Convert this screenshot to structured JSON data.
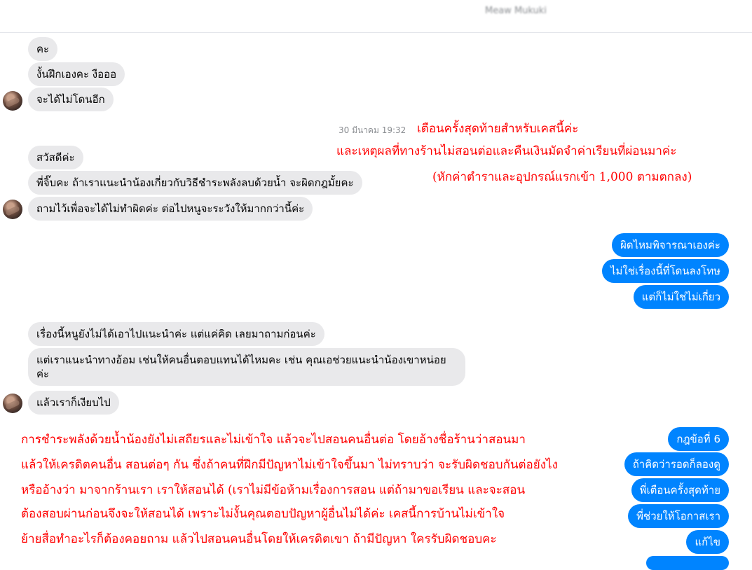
{
  "header": {
    "contact_name": "Meaw Mukuki"
  },
  "timestamp": "30 มีนาคม 19:32",
  "messages_group1": [
    "คะ",
    "งั้นฝึกเองคะ งือออ",
    "จะได้ไม่โดนอีก"
  ],
  "messages_group2": [
    "สวัสดีค่ะ",
    "พี่จิ๊บคะ ถ้าเราแนะนำน้องเกี่ยวกับวิธีชำระพลังลบด้วยน้ำ จะผิดกฎมั้ยคะ",
    "ถามไว้เพื่อจะได้ไม่ทำผิดค่ะ ต่อไปหนูจะระวังให้มากกว่านี้ค่ะ"
  ],
  "messages_out1": [
    "ผิดไหมพิจารณาเองค่ะ",
    "ไม่ใช่เรื่องนี้ที่โดนลงโทษ",
    "แต่ก็ไม่ใช่ไม่เกี่ยว"
  ],
  "messages_group3": [
    "เรื่องนี้หนูยังไม่ได้เอาไปแนะนำค่ะ แต่แค่คิด เลยมาถามก่อนค่ะ",
    "แต่เราแนะนำทางอ้อม เช่นให้คนอื่นตอบแทนได้ไหมคะ เช่น คุณเอช่วยแนะนำน้องเขาหน่อยค่ะ",
    "แล้วเราก็เงียบไป"
  ],
  "messages_out2": [
    "กฎข้อที่ 6",
    "ถ้าคิดว่ารอดก็ลองดู",
    "พี่เตือนครั้งสุดท้าย",
    "พี่ช่วยให้โอกาสเรา",
    "แก้ไข"
  ],
  "annotation_top": [
    "เตือนครั้งสุดท้ายสำหรับเคสนี้ค่ะ",
    "และเหตุผลที่ทางร้านไม่สอนต่อและคืนเงินมัดจำค่าเรียนที่ผ่อนมาค่ะ",
    "(หักค่าตำราและอุปกรณ์แรกเข้า 1,000 ตามตกลง)"
  ],
  "annotation_bottom": [
    "การชำระพลังด้วยน้ำน้องยังไม่เสถียรและไม่เข้าใจ แล้วจะไปสอนคนอื่นต่อ โดยอ้างชื่อร้านว่าสอนมา",
    "แล้วให้เครดิตคนอื่น สอนต่อๆ กัน ซึ่งถ้าคนที่ฝึกมีปัญหาไม่เข้าใจขึ้นมา ไม่ทราบว่า จะรับผิดชอบกันต่อยังไง",
    "หรืออ้างว่า มาจากร้านเรา เราให้สอนได้ (เราไม่มีข้อห้ามเรื่องการสอน แต่ถ้ามาขอเรียน และจะสอน",
    "ต้องสอบผ่านก่อนจึงจะให้สอนได้ เพราะไม่งั้นคุณตอบปัญหาผู้อื่นไม่ได้ค่ะ เคสนี้การบ้านไม่เข้าใจ",
    "ย้ายสื่อทำอะไรก็ต้องคอยถาม แล้วไปสอนคนอื่นโดยให้เครดิตเขา ถ้ามีปัญหา ใครรับผิดชอบคะ"
  ],
  "colors": {
    "incoming_bubble": "#e9e9eb",
    "outgoing_bubble": "#0084ff",
    "annotation_text": "#ff0000"
  }
}
